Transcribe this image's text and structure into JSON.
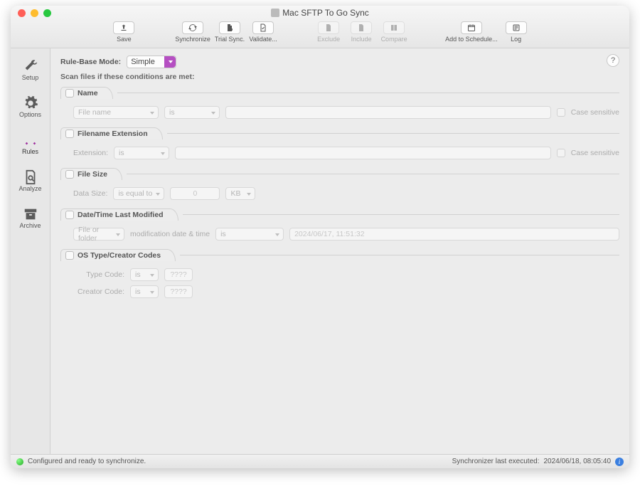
{
  "window": {
    "title": "Mac SFTP To Go Sync"
  },
  "toolbar": {
    "save": "Save",
    "synchronize": "Synchronize",
    "trial_sync": "Trial Sync.",
    "validate": "Validate...",
    "exclude": "Exclude",
    "include": "Include",
    "compare": "Compare",
    "add_schedule": "Add to Schedule...",
    "log": "Log"
  },
  "sidebar": {
    "items": [
      "Setup",
      "Options",
      "Rules",
      "Analyze",
      "Archive"
    ],
    "active_index": 2
  },
  "top": {
    "rule_base_label": "Rule-Base Mode:",
    "rule_base_value": "Simple",
    "scan_label": "Scan files if these conditions are met:"
  },
  "sections": {
    "name": {
      "title": "Name",
      "field_selector": "File name",
      "operator": "is",
      "value": "",
      "case_sensitive_label": "Case sensitive"
    },
    "ext": {
      "title": "Filename Extension",
      "label": "Extension:",
      "operator": "is",
      "value": "",
      "case_sensitive_label": "Case sensitive"
    },
    "size": {
      "title": "File Size",
      "label": "Data Size:",
      "operator": "is equal to",
      "value": "0",
      "unit": "KB"
    },
    "date": {
      "title": "Date/Time Last Modified",
      "target": "File or folder",
      "attribute": "modification date & time",
      "operator": "is",
      "value": "2024/06/17, 11:51:32"
    },
    "os": {
      "title": "OS Type/Creator Codes",
      "type_label": "Type Code:",
      "type_op": "is",
      "type_value": "????",
      "creator_label": "Creator Code:",
      "creator_op": "is",
      "creator_value": "????"
    }
  },
  "status": {
    "left": "Configured and ready to synchronize.",
    "right_label": "Synchronizer last executed:",
    "right_time": "2024/06/18, 08:05:40"
  }
}
